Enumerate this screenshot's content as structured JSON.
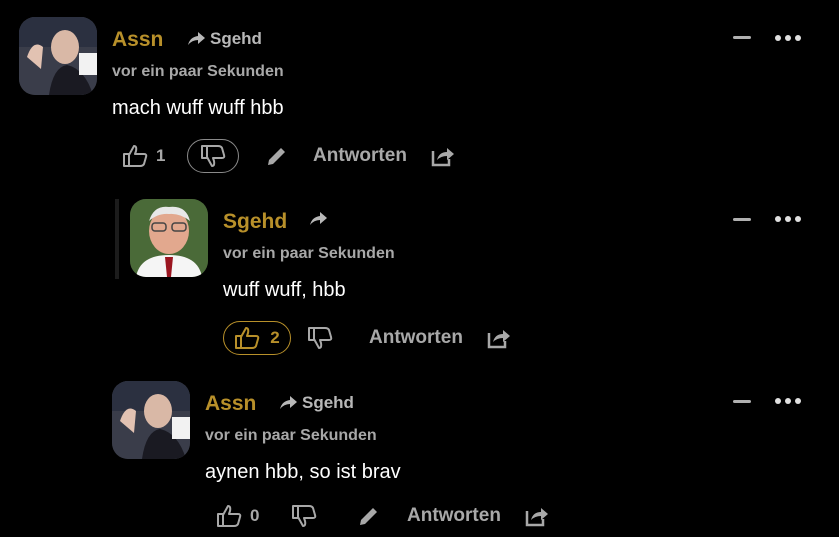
{
  "theme": {
    "accent": "#b8902a",
    "background": "#000000",
    "muted": "#a8a8a8"
  },
  "comments": [
    {
      "author": "Assn",
      "reply_to": "Sgehd",
      "time": "vor ein paar Sekunden",
      "text": "mach wuff wuff hbb",
      "likes": "1",
      "dislike_active": true,
      "reply_label": "Antworten",
      "avatar_icon": "user-avatar-image"
    },
    {
      "author": "Sgehd",
      "reply_to": "",
      "time": "vor ein paar Sekunden",
      "text": "wuff wuff, hbb",
      "likes": "2",
      "like_active": true,
      "reply_label": "Antworten",
      "avatar_icon": "user-avatar-image"
    },
    {
      "author": "Assn",
      "reply_to": "Sgehd",
      "time": "vor ein paar Sekunden",
      "text": "aynen hbb, so ist brav",
      "likes": "0",
      "reply_label": "Antworten",
      "avatar_icon": "user-avatar-image"
    }
  ]
}
